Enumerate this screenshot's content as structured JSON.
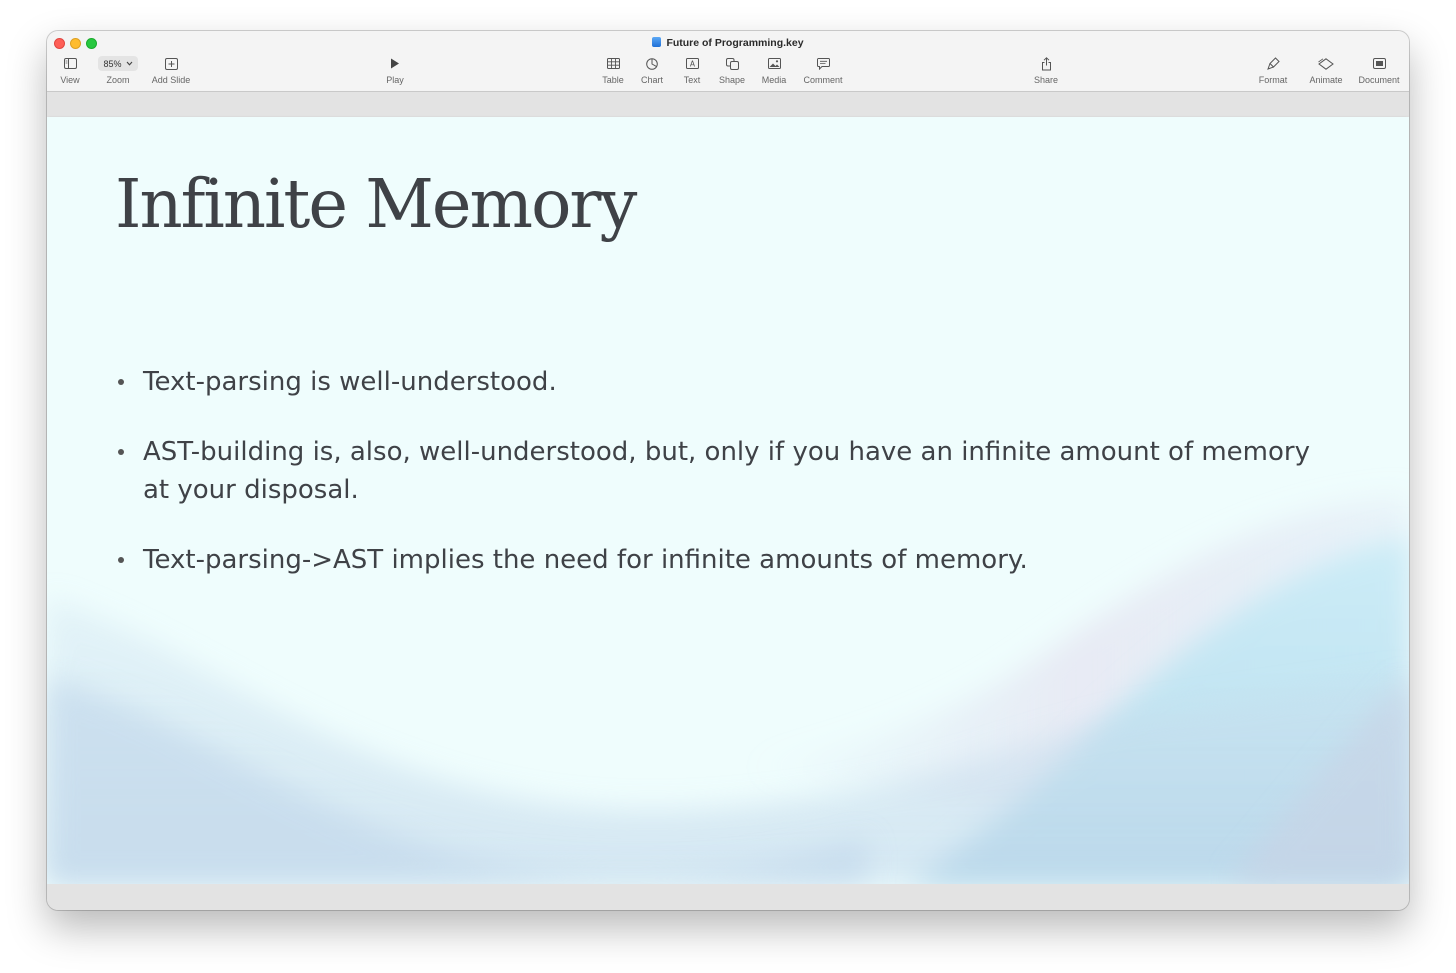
{
  "window": {
    "title": "Future of Programming.key"
  },
  "toolbar": {
    "view": {
      "label": "View",
      "icon": "sidebar-icon"
    },
    "zoom": {
      "label": "Zoom",
      "value": "85%",
      "icon": "chevron-down-icon"
    },
    "add_slide": {
      "label": "Add Slide",
      "icon": "plus-square-icon"
    },
    "play": {
      "label": "Play",
      "icon": "play-icon"
    },
    "table": {
      "label": "Table",
      "icon": "table-icon"
    },
    "chart": {
      "label": "Chart",
      "icon": "pie-chart-icon"
    },
    "text": {
      "label": "Text",
      "icon": "text-box-icon"
    },
    "shape": {
      "label": "Shape",
      "icon": "shape-icon"
    },
    "media": {
      "label": "Media",
      "icon": "image-icon"
    },
    "comment": {
      "label": "Comment",
      "icon": "comment-icon"
    },
    "share": {
      "label": "Share",
      "icon": "share-icon"
    },
    "format": {
      "label": "Format",
      "icon": "paintbrush-icon"
    },
    "animate": {
      "label": "Animate",
      "icon": "diamond-icon"
    },
    "document": {
      "label": "Document",
      "icon": "document-icon"
    }
  },
  "slide": {
    "title": "Infinite Memory",
    "bullets": [
      "Text-parsing is well-understood.",
      "AST-building is, also, well-understood, but, only if you have an infinite amount of memory at your disposal.",
      "Text-parsing->AST implies the need for infinite amounts of memory."
    ]
  },
  "colors": {
    "slide_background": "#effdfd",
    "text": "#3f4247",
    "close": "#fe5f57",
    "minimize": "#febc2e",
    "maximize": "#28c840"
  }
}
